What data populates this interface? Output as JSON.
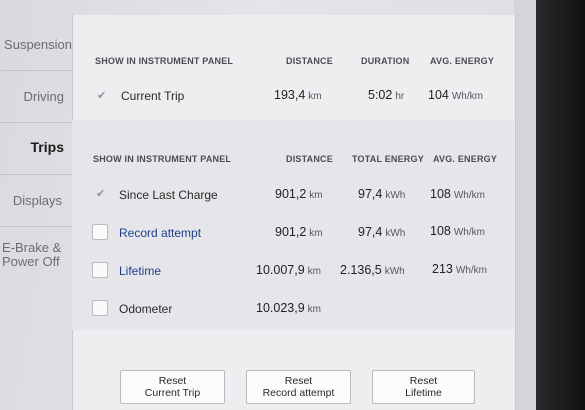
{
  "sidebar": {
    "items": [
      {
        "label": "Suspension"
      },
      {
        "label": "Driving"
      },
      {
        "label": "Trips"
      },
      {
        "label": "Displays"
      },
      {
        "label": "E-Brake &"
      },
      {
        "label": "Power Off"
      }
    ]
  },
  "section1": {
    "headers": {
      "show": "SHOW IN INSTRUMENT PANEL",
      "distance": "DISTANCE",
      "duration": "DURATION",
      "avg_energy": "AVG. ENERGY"
    },
    "row": {
      "label": "Current Trip",
      "distance": "193,4",
      "distance_unit": "km",
      "duration": "5:02",
      "duration_unit": "hr",
      "energy": "104",
      "energy_unit": "Wh/km",
      "checked": true
    }
  },
  "section2": {
    "headers": {
      "show": "SHOW IN INSTRUMENT PANEL",
      "distance": "DISTANCE",
      "total_energy": "TOTAL ENERGY",
      "avg_energy": "AVG. ENERGY"
    },
    "rows": [
      {
        "label": "Since Last Charge",
        "distance": "901,2",
        "distance_unit": "km",
        "total": "97,4",
        "total_unit": "kWh",
        "avg": "108",
        "avg_unit": "Wh/km",
        "checked": true
      },
      {
        "label": "Record attempt",
        "distance": "901,2",
        "distance_unit": "km",
        "total": "97,4",
        "total_unit": "kWh",
        "avg": "108",
        "avg_unit": "Wh/km",
        "checked": false
      },
      {
        "label": "Lifetime",
        "distance": "10.007,9",
        "distance_unit": "km",
        "total": "2.136,5",
        "total_unit": "kWh",
        "avg": "213",
        "avg_unit": "Wh/km",
        "checked": false
      },
      {
        "label": "Odometer",
        "distance": "10.023,9",
        "distance_unit": "km",
        "checked": false
      }
    ]
  },
  "buttons": {
    "reset_current": {
      "line1": "Reset",
      "line2": "Current Trip"
    },
    "reset_record": {
      "line1": "Reset",
      "line2": "Record attempt"
    },
    "reset_lifetime": {
      "line1": "Reset",
      "line2": "Lifetime"
    }
  }
}
